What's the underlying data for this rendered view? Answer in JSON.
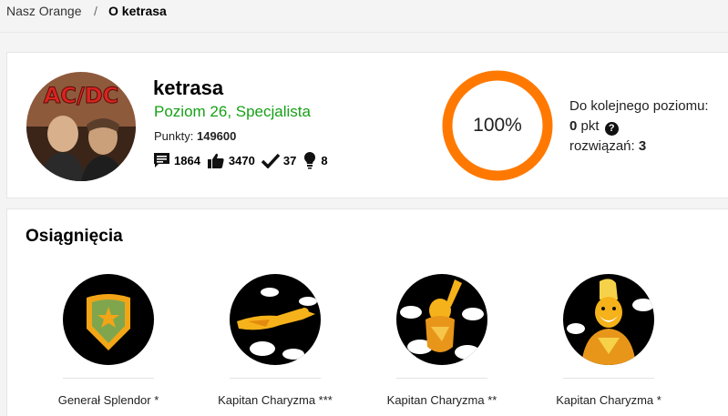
{
  "breadcrumb": {
    "home": "Nasz Orange",
    "separator": "/",
    "current": "O ketrasa"
  },
  "profile": {
    "username": "ketrasa",
    "level": "Poziom 26, Specjalista",
    "points_label": "Punkty:",
    "points_value": "149600",
    "avatar_text": "AC/DC",
    "stats": {
      "posts": "1864",
      "likes": "3470",
      "solutions": "37",
      "ideas": "8"
    },
    "progress_label": "100%",
    "progress": 1.0,
    "next_level": {
      "title": "Do kolejnego poziomu:",
      "points_value": "0",
      "points_unit": "pkt",
      "solved_label": "rozwiązań:",
      "solved_value": "3"
    }
  },
  "achievements": {
    "title": "Osiągnięcia",
    "items": [
      {
        "name": "Generał Splendor *",
        "icon": "shield-star-icon"
      },
      {
        "name": "Kapitan Charyzma ***",
        "icon": "flying-hero-icon"
      },
      {
        "name": "Kapitan Charyzma **",
        "icon": "rising-hero-icon"
      },
      {
        "name": "Kapitan Charyzma *",
        "icon": "standing-hero-icon"
      }
    ]
  },
  "colors": {
    "accent": "#ff7900",
    "level_green": "#16a116",
    "hero_yellow": "#f6b21a"
  }
}
